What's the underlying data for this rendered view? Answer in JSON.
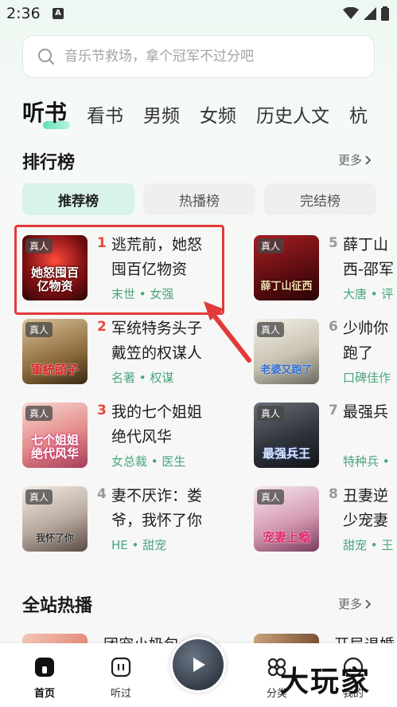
{
  "status": {
    "time": "2:36",
    "notif_letter": "A"
  },
  "search": {
    "placeholder": "音乐节救场，拿个冠军不过分吧"
  },
  "tabs": [
    "听书",
    "看书",
    "男频",
    "女频",
    "历史人文",
    "杭"
  ],
  "ranking": {
    "title": "排行榜",
    "more": "更多",
    "subtabs": [
      "推荐榜",
      "热播榜",
      "完结榜"
    ],
    "badge": "真人",
    "items": [
      {
        "rank": "1",
        "title_line1": "逃荒前，她怒",
        "title_line2": "囤百亿物资",
        "tags": "末世 • 女强",
        "cover_text": "她怒囤百亿物资",
        "rank_color": "#e8473b"
      },
      {
        "rank": "2",
        "title_line1": "军统特务头子",
        "title_line2": "戴笠的权谋人",
        "tags": "名著 • 权谋",
        "cover_text": "軍統頭子",
        "rank_color": "#e8473b"
      },
      {
        "rank": "3",
        "title_line1": "我的七个姐姐",
        "title_line2": "绝代风华",
        "tags": "女总裁 • 医生",
        "cover_text": "七个姐姐绝代风华",
        "rank_color": "#e8473b"
      },
      {
        "rank": "4",
        "title_line1": "妻不厌诈：娄",
        "title_line2": "爷，我怀了你",
        "tags": "HE • 甜宠",
        "cover_text": "我怀了你",
        "rank_color": "#999999"
      },
      {
        "rank": "5",
        "title_line1": "薛丁山",
        "title_line2": "西-邵军",
        "tags": "大唐 • 评",
        "cover_text": "薛丁山征西",
        "rank_color": "#999999"
      },
      {
        "rank": "6",
        "title_line1": "少帅你",
        "title_line2": "跑了",
        "tags": "口碑佳作",
        "cover_text": "老婆又跑了",
        "rank_color": "#999999"
      },
      {
        "rank": "7",
        "title_line1": "最强兵",
        "title_line2": "",
        "tags": "特种兵 •",
        "cover_text": "最强兵王",
        "rank_color": "#999999"
      },
      {
        "rank": "8",
        "title_line1": "丑妻逆",
        "title_line2": "少宠妻",
        "tags": "甜宠 • 王",
        "cover_text": "宠妻上瘾",
        "rank_color": "#999999"
      }
    ]
  },
  "hot": {
    "title": "全站热播",
    "more": "更多",
    "left_partial": "团宠小奶包",
    "right_partial": "开局退婚"
  },
  "bottom_nav": {
    "home": "首页",
    "history": "听过",
    "category": "分类",
    "mine": "我的"
  },
  "watermark": "大玩家",
  "colors": {
    "accent_green": "#4aa57f",
    "rank_red": "#e8473b",
    "highlight_red": "#e23a3a"
  }
}
